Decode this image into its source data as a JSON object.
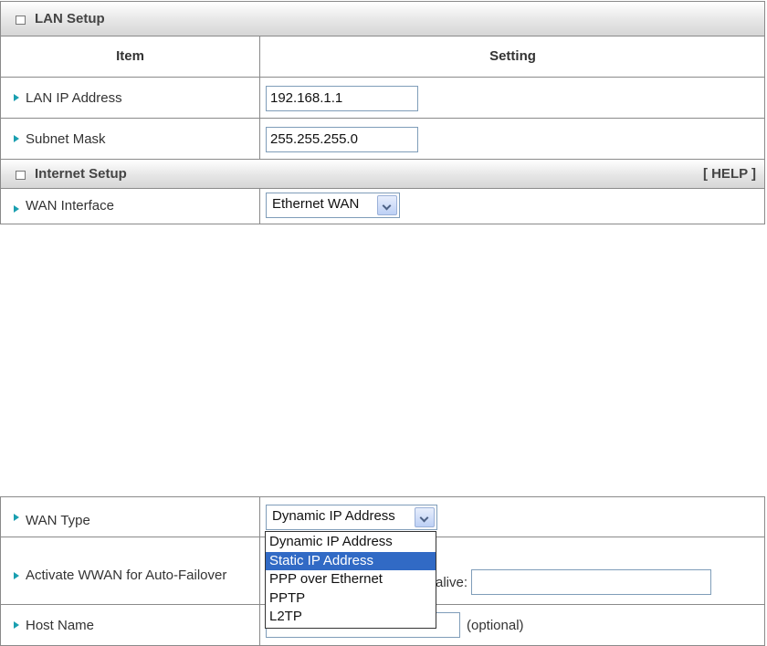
{
  "lan": {
    "section_title": "LAN Setup",
    "header_item": "Item",
    "header_setting": "Setting",
    "ip_label": "LAN IP Address",
    "ip_value": "192.168.1.1",
    "mask_label": "Subnet Mask",
    "mask_value": "255.255.255.0"
  },
  "internet": {
    "section_title": "Internet Setup",
    "help_link": "[ HELP ]",
    "wan_interface_label": "WAN Interface",
    "wan_interface_value": "Ethernet WAN"
  },
  "wan": {
    "type_label": "WAN Type",
    "type_value": "Dynamic IP Address",
    "options": [
      "Dynamic IP Address",
      "Static IP Address",
      "PPP over Ethernet",
      "PPTP",
      "L2TP"
    ],
    "highlighted_option": "Static IP Address",
    "failover_label": "Activate WWAN for Auto-Failover",
    "keepalive_partial": "alive:",
    "keepalive_value": "",
    "host_label": "Host Name",
    "host_value": "",
    "host_hint": "(optional)"
  },
  "colors": {
    "arrow_accent": "#1a9fb0",
    "highlight": "#316ac5"
  }
}
